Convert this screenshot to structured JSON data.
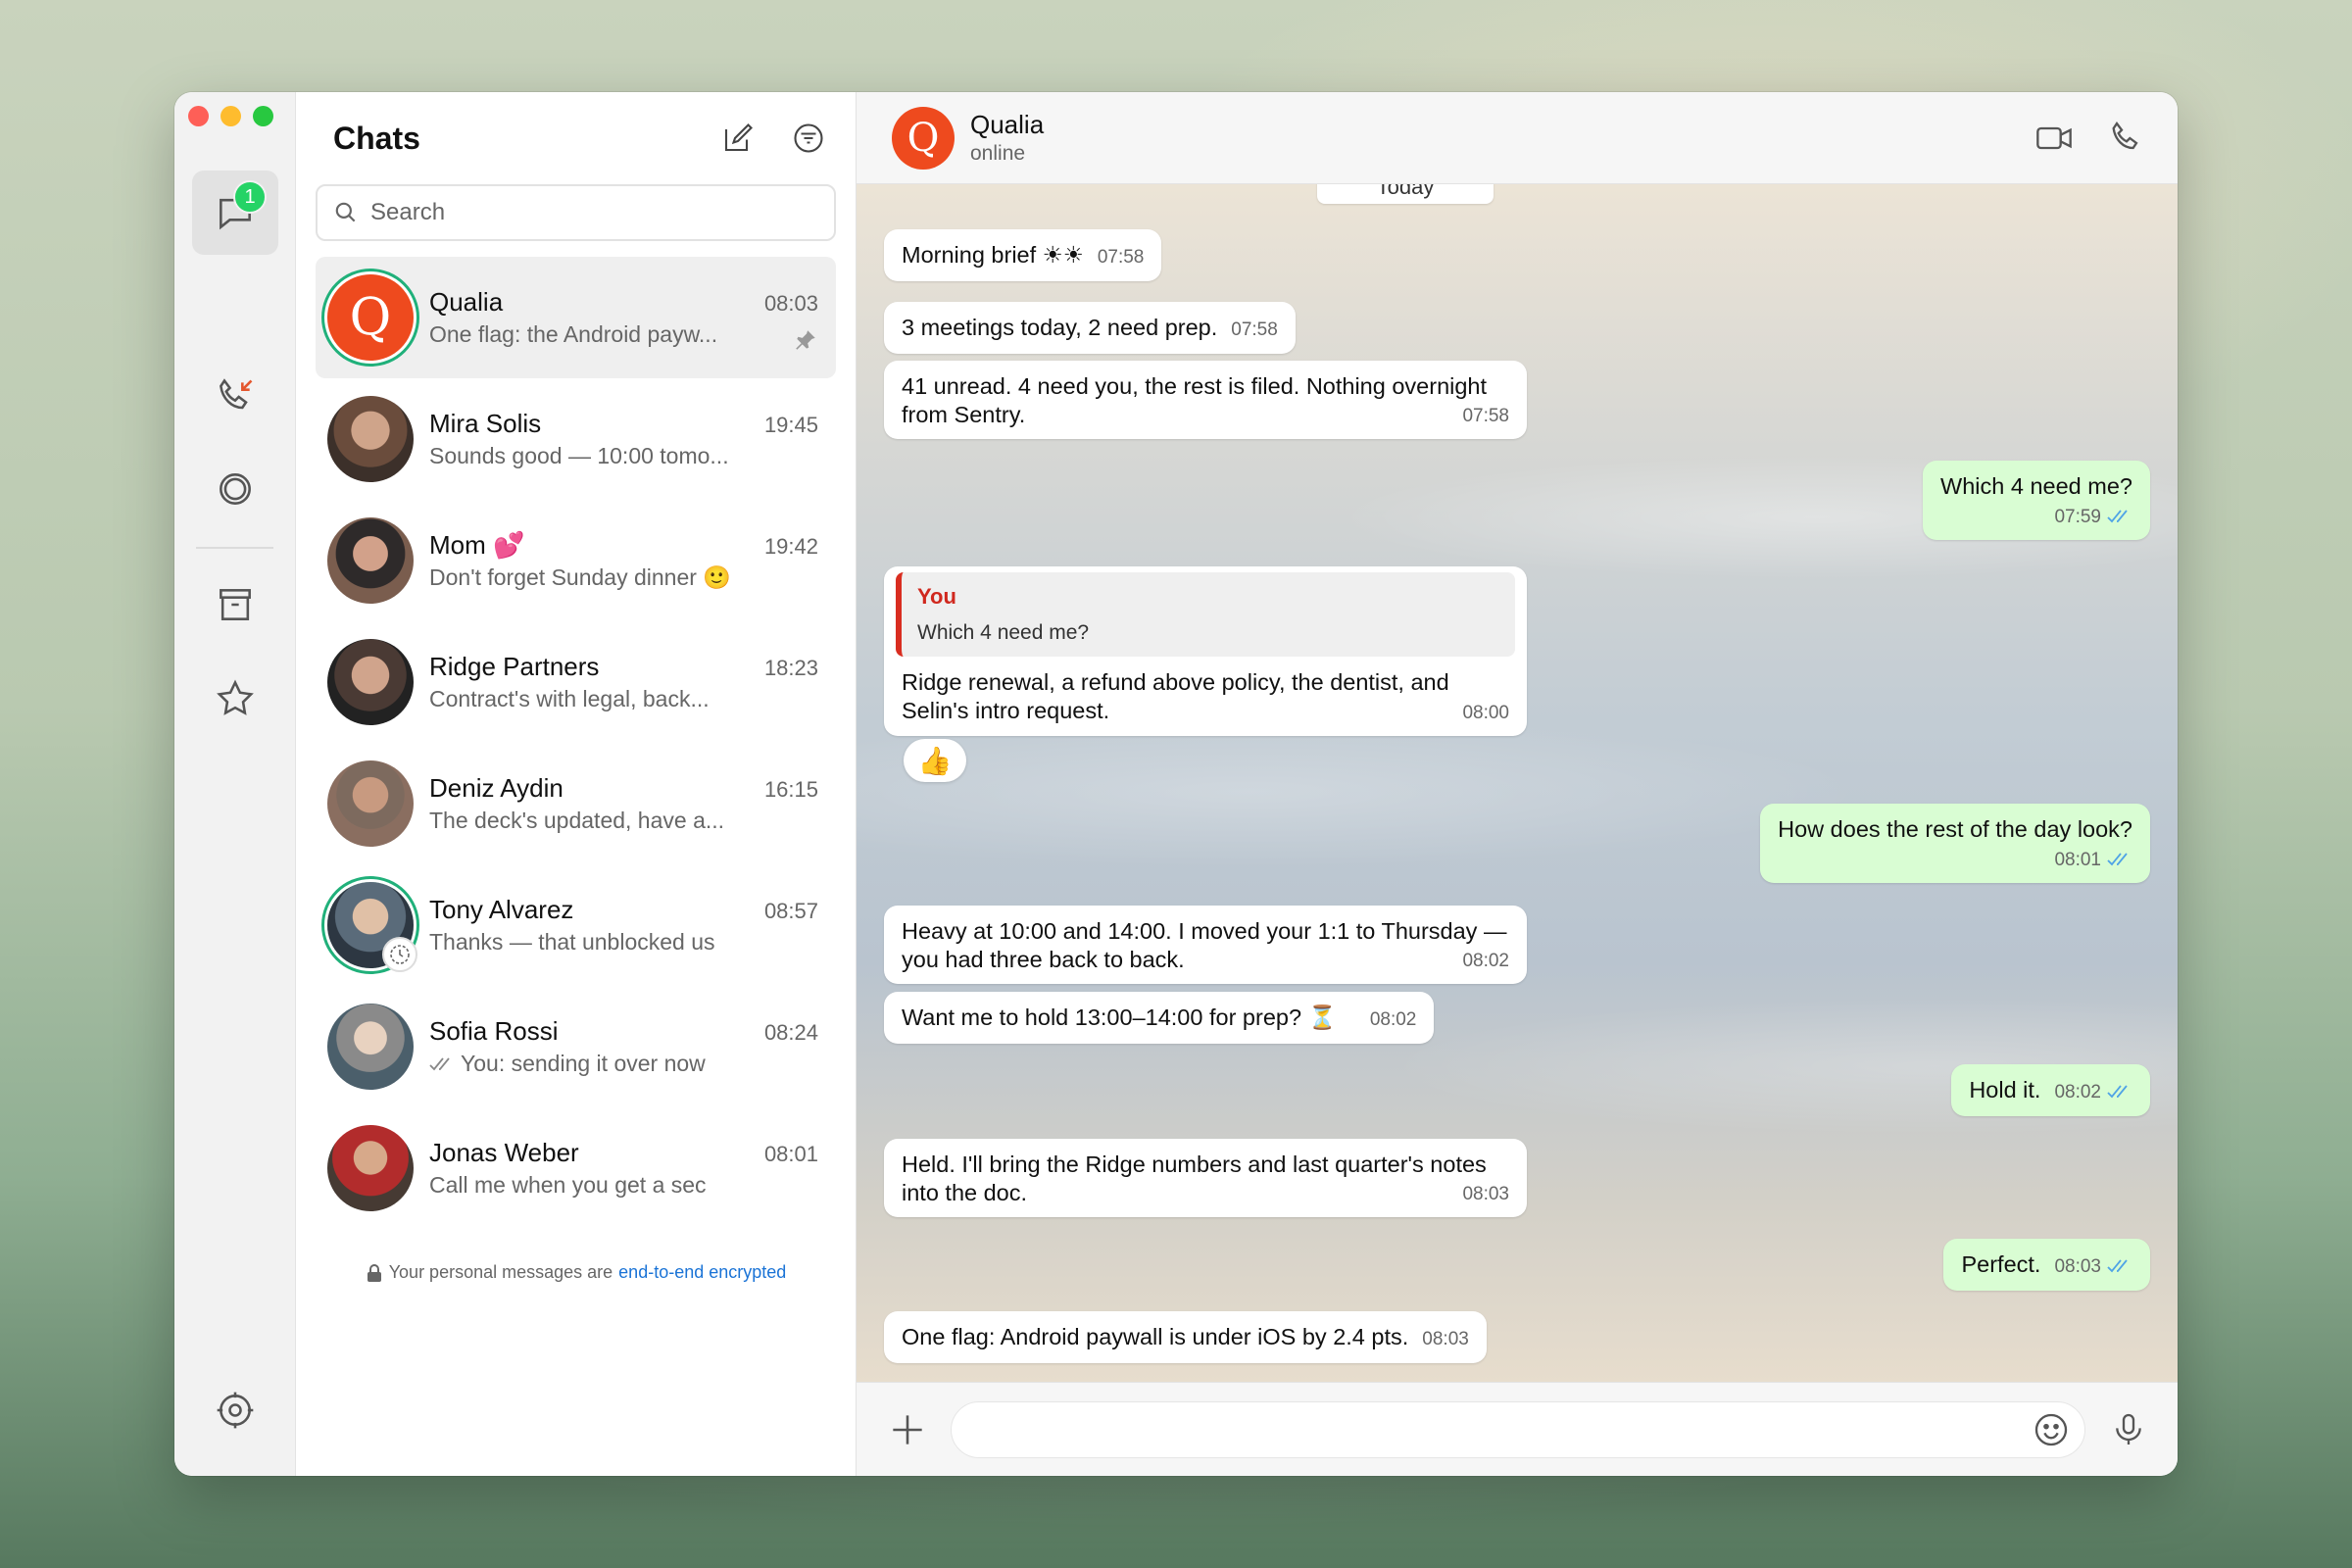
{
  "window": {
    "list_title": "Chats",
    "search_placeholder": "Search"
  },
  "rail": {
    "chats_badge": "1"
  },
  "chats": [
    {
      "name": "Qualia",
      "time": "08:03",
      "preview": "One flag: the Android payw...",
      "avatar_letter": "Q",
      "pinned": true
    },
    {
      "name": "Mira Solis",
      "time": "19:45",
      "preview": "Sounds good — 10:00 tomo..."
    },
    {
      "name": "Mom 💕",
      "time": "19:42",
      "preview": "Don't forget Sunday dinner 🙂"
    },
    {
      "name": "Ridge Partners",
      "time": "18:23",
      "preview": "Contract's with legal, back..."
    },
    {
      "name": "Deniz Aydin",
      "time": "16:15",
      "preview": "The deck's updated, have a..."
    },
    {
      "name": "Tony Alvarez",
      "time": "08:57",
      "preview": "Thanks — that unblocked us"
    },
    {
      "name": "Sofia Rossi",
      "time": "08:24",
      "preview": "You: sending it over now"
    },
    {
      "name": "Jonas Weber",
      "time": "08:01",
      "preview": "Call me when you get a sec"
    }
  ],
  "e2e": {
    "text": "Your personal messages are",
    "link": "end-to-end encrypted"
  },
  "conversation": {
    "name": "Qualia",
    "status": "online",
    "avatar_letter": "Q",
    "day_label": "Today",
    "messages": [
      {
        "text": "Morning brief ☀☀",
        "time": "07:58",
        "dir": "in"
      },
      {
        "text": "3 meetings today, 2 need prep.",
        "time": "07:58",
        "dir": "in"
      },
      {
        "text": "41 unread. 4 need you, the rest is filed. Nothing overnight from Sentry.",
        "time": "07:58",
        "dir": "in"
      },
      {
        "text": "Which 4 need me?",
        "time": "07:59",
        "dir": "out"
      },
      {
        "quote_who": "You",
        "quote_text": "Which 4 need me?",
        "text": "Ridge renewal, a refund above policy, the dentist, and Selin's intro request.",
        "time": "08:00",
        "dir": "in",
        "reaction": "👍"
      },
      {
        "text": "How does the rest of the day look?",
        "time": "08:01",
        "dir": "out"
      },
      {
        "text": "Heavy at 10:00 and 14:00. I moved your 1:1 to Thursday — you had three back to back.",
        "time": "08:02",
        "dir": "in"
      },
      {
        "text": "Want me to hold 13:00–14:00 for prep? ⏳",
        "time": "08:02",
        "dir": "in"
      },
      {
        "text": "Hold it.",
        "time": "08:02",
        "dir": "out"
      },
      {
        "text": "Held. I'll bring the Ridge numbers and last quarter's notes into the doc.",
        "time": "08:03",
        "dir": "in"
      },
      {
        "text": "Perfect.",
        "time": "08:03",
        "dir": "out"
      },
      {
        "text": "One flag: Android paywall is under iOS by 2.4 pts.",
        "time": "08:03",
        "dir": "in"
      }
    ]
  },
  "composer": {
    "placeholder": ""
  }
}
